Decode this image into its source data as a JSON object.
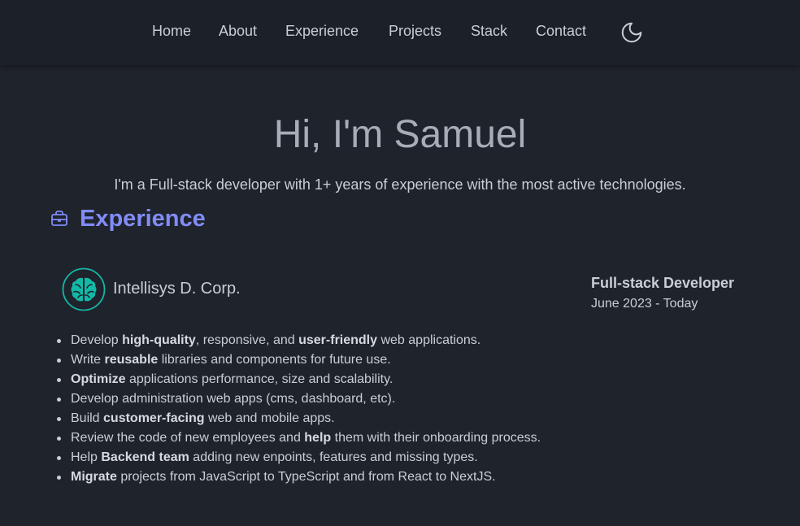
{
  "nav": {
    "items": [
      {
        "label": "Home"
      },
      {
        "label": "About"
      },
      {
        "label": "Experience"
      },
      {
        "label": "Projects"
      },
      {
        "label": "Stack"
      },
      {
        "label": "Contact"
      }
    ],
    "theme_toggle_icon": "moon-icon"
  },
  "hero": {
    "title": "Hi, I'm Samuel",
    "subtitle": "I'm a Full-stack developer with 1+ years of experience with the most active technologies."
  },
  "experience": {
    "icon": "briefcase-icon",
    "title": "Experience",
    "jobs": [
      {
        "company_logo": "brain-icon",
        "company": "Intellisys D. Corp.",
        "role": "Full-stack Developer",
        "period": "June 2023 - Today",
        "tasks": [
          [
            {
              "t": "Develop "
            },
            {
              "b": "high-quality"
            },
            {
              "t": ", responsive, and "
            },
            {
              "b": "user-friendly"
            },
            {
              "t": " web applications."
            }
          ],
          [
            {
              "t": "Write "
            },
            {
              "b": "reusable"
            },
            {
              "t": " libraries and components for future use."
            }
          ],
          [
            {
              "b": "Optimize"
            },
            {
              "t": " applications performance, size and scalability."
            }
          ],
          [
            {
              "t": "Develop administration web apps (cms, dashboard, etc)."
            }
          ],
          [
            {
              "t": "Build "
            },
            {
              "b": "customer-facing"
            },
            {
              "t": " web and mobile apps."
            }
          ],
          [
            {
              "t": "Review the code of new employees and "
            },
            {
              "b": "help"
            },
            {
              "t": " them with their onboarding process."
            }
          ],
          [
            {
              "t": "Help "
            },
            {
              "b": "Backend team"
            },
            {
              "t": " adding new enpoints, features and missing types."
            }
          ],
          [
            {
              "b": "Migrate"
            },
            {
              "t": " projects from JavaScript to TypeScript and from React to NextJS."
            }
          ]
        ]
      }
    ]
  },
  "colors": {
    "background": "#1f232b",
    "nav_background": "#1c2028",
    "accent": "#818cf8",
    "logo_teal": "#14b8a6",
    "text": "#c9ced6"
  }
}
